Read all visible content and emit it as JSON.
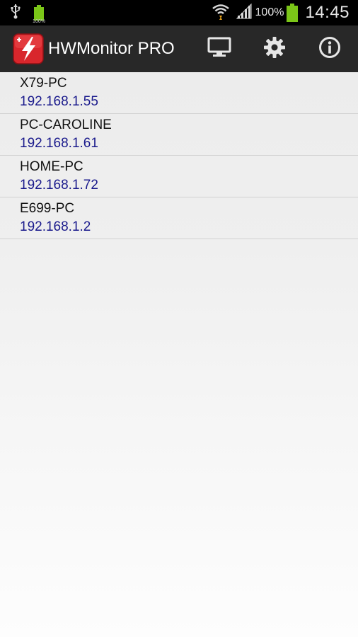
{
  "status_bar": {
    "small_battery_text": "100%",
    "signal_text": "100%",
    "time": "14:45",
    "icons": [
      "usb-icon",
      "battery-icon",
      "wifi-icon",
      "cell-signal-icon",
      "battery-icon"
    ]
  },
  "action_bar": {
    "title": "HWMonitor PRO",
    "logo_color": "#d8262c",
    "icons": [
      "monitor-icon",
      "gear-icon",
      "info-icon"
    ]
  },
  "devices": [
    {
      "name": "X79-PC",
      "ip": "192.168.1.55"
    },
    {
      "name": "PC-CAROLINE",
      "ip": "192.168.1.61"
    },
    {
      "name": "HOME-PC",
      "ip": "192.168.1.72"
    },
    {
      "name": "E699-PC",
      "ip": "192.168.1.2"
    }
  ],
  "colors": {
    "ip_text": "#1a1a8c",
    "battery": "#7bc618",
    "action_bar": "#282828"
  }
}
